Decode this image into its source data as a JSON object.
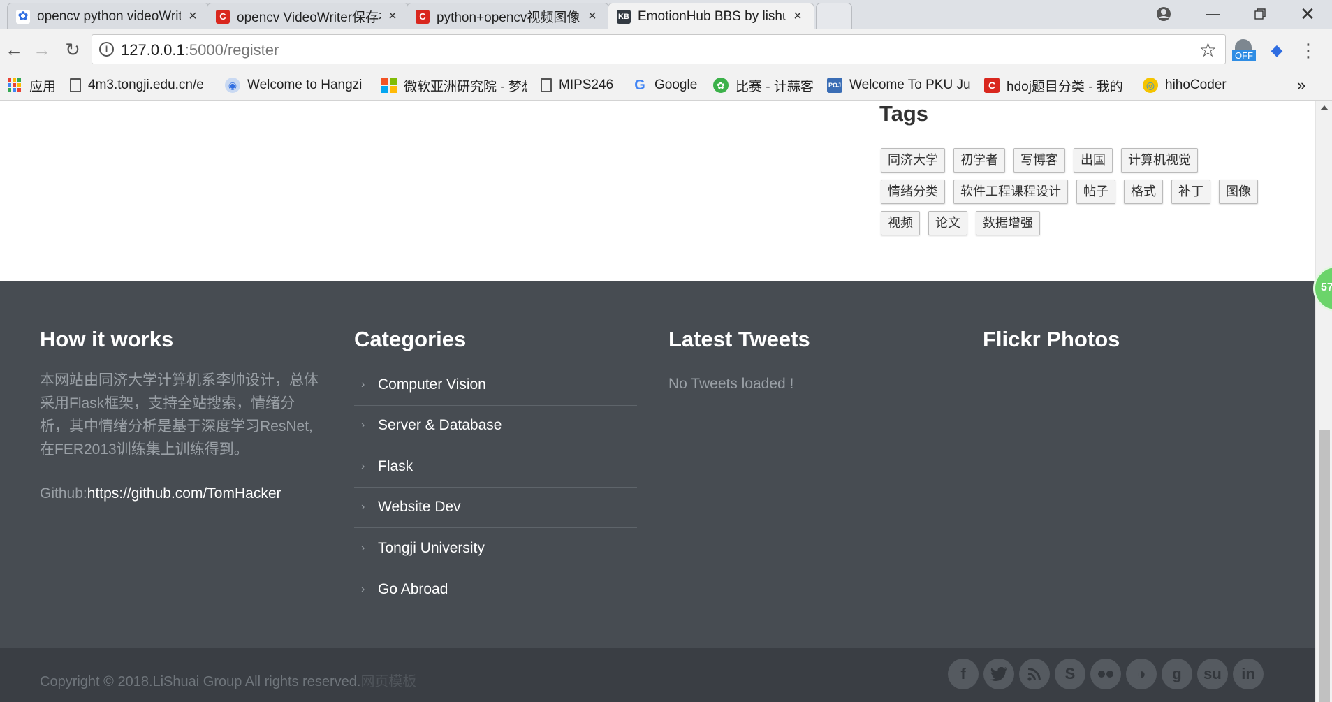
{
  "browser": {
    "tabs": [
      {
        "title": "opencv python videoWriter",
        "close": "×",
        "favicon": "paw-icon",
        "favicon_color": "#2f6de1"
      },
      {
        "title": "opencv VideoWriter保存视频",
        "close": "×",
        "favicon": "csdn-icon",
        "favicon_color": "#d9271e"
      },
      {
        "title": "python+opencv视频图像",
        "close": "×",
        "favicon": "csdn-icon",
        "favicon_color": "#d9271e"
      },
      {
        "title": "EmotionHub BBS by lishuai",
        "close": "×",
        "favicon": "kb-icon",
        "favicon_color": "#333a42"
      }
    ],
    "url_host": "127.0.0.1",
    "url_path": ":5000/register",
    "extension_label": "OFF",
    "bookmarks": [
      {
        "label": "应用",
        "icon": "apps-grid-icon"
      },
      {
        "label": "4m3.tongji.edu.cn/e",
        "icon": "page-icon"
      },
      {
        "label": "Welcome to Hangzi",
        "icon": "globe-icon"
      },
      {
        "label": "微软亚洲研究院 - 梦想",
        "icon": "windows-icon"
      },
      {
        "label": "MIPS246",
        "icon": "page-icon"
      },
      {
        "label": "Google",
        "icon": "google-icon"
      },
      {
        "label": "比赛 - 计蒜客",
        "icon": "garlic-icon"
      },
      {
        "label": "Welcome To PKU Ju",
        "icon": "poj-icon"
      },
      {
        "label": "hdoj题目分类 - 我的",
        "icon": "csdn-icon"
      },
      {
        "label": "hihoCoder",
        "icon": "hihocoder-icon"
      }
    ],
    "bookmarks_overflow": "»"
  },
  "sidebar": {
    "tags_title": "Tags",
    "tags": [
      "同济大学",
      "初学者",
      "写博客",
      "出国",
      "计算机视觉",
      "情绪分类",
      "软件工程课程设计",
      "帖子",
      "格式",
      "补丁",
      "图像",
      "视频",
      "论文",
      "数据增强"
    ]
  },
  "footer": {
    "how_title": "How it works",
    "how_text": "本网站由同济大学计算机系李帅设计，总体采用Flask框架，支持全站搜索，情绪分析，其中情绪分析是基于深度学习ResNet,在FER2013训练集上训练得到。",
    "github_label": "Github:",
    "github_link": "https://github.com/TomHacker",
    "categories_title": "Categories",
    "categories": [
      "Computer Vision",
      "Server & Database",
      "Flask",
      "Website Dev",
      "Tongji University",
      "Go Abroad"
    ],
    "tweets_title": "Latest Tweets",
    "tweets_empty": "No Tweets loaded !",
    "flickr_title": "Flickr Photos",
    "copyright": "Copyright © 2018.LiShuai Group All rights reserved.",
    "copyright_hint": "网页模板",
    "social": [
      "facebook-icon",
      "twitter-icon",
      "rss-icon",
      "skype-icon",
      "flickr-icon",
      "dribbble-icon",
      "google-icon",
      "stumbleupon-icon",
      "linkedin-icon"
    ]
  },
  "badge": "57"
}
